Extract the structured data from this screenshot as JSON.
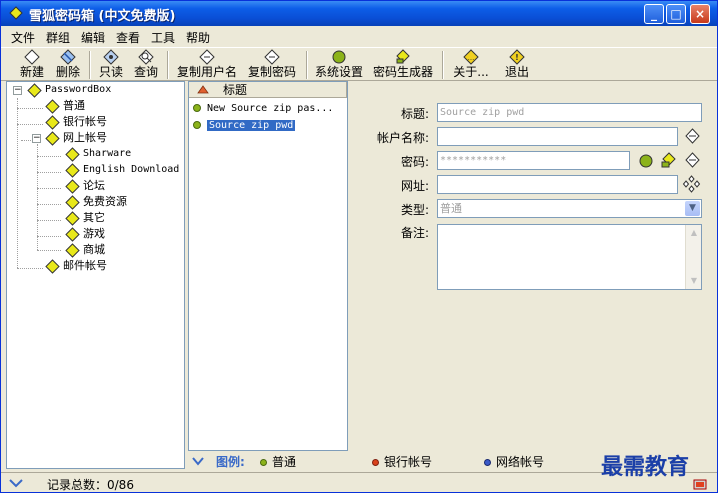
{
  "window": {
    "title": "雪狐密码箱 (中文免费版)"
  },
  "menu": [
    "文件",
    "群组",
    "编辑",
    "查看",
    "工具",
    "帮助"
  ],
  "toolbar": {
    "new": "新建",
    "delete": "删除",
    "readonly": "只读",
    "query": "查询",
    "copy_user": "复制用户名",
    "copy_pwd": "复制密码",
    "settings": "系统设置",
    "generator": "密码生成器",
    "about": "关于...",
    "exit": "退出"
  },
  "tree": {
    "root": "PasswordBox",
    "n_general": "普通",
    "n_bank": "银行帐号",
    "n_web": "网上帐号",
    "c_shareware": "Sharware",
    "c_english": "English Download",
    "c_forum": "论坛",
    "c_free": "免费资源",
    "c_other": "其它",
    "c_game": "游戏",
    "c_mall": "商城",
    "n_mail": "邮件帐号"
  },
  "list": {
    "header": "标题",
    "rows": [
      "New Source zip pas...",
      "Source zip pwd"
    ]
  },
  "form": {
    "title_label": "标题:",
    "title_value": "Source zip pwd",
    "account_label": "帐户名称:",
    "account_value": "",
    "password_label": "密码:",
    "password_value": "***********",
    "url_label": "网址:",
    "url_value": "",
    "type_label": "类型:",
    "type_value": "普通",
    "note_label": "备注:"
  },
  "legend": {
    "label": "图例:",
    "general": "普通",
    "bank": "银行帐号",
    "net": "网络帐号"
  },
  "status": {
    "text": "记录总数：0/86"
  },
  "watermark": "最需教育",
  "colors": {
    "accent": "#0a4ed5",
    "selection": "#316ac5",
    "green": "#8cb31a",
    "red": "#d9421a",
    "blue": "#3a5ac8"
  }
}
